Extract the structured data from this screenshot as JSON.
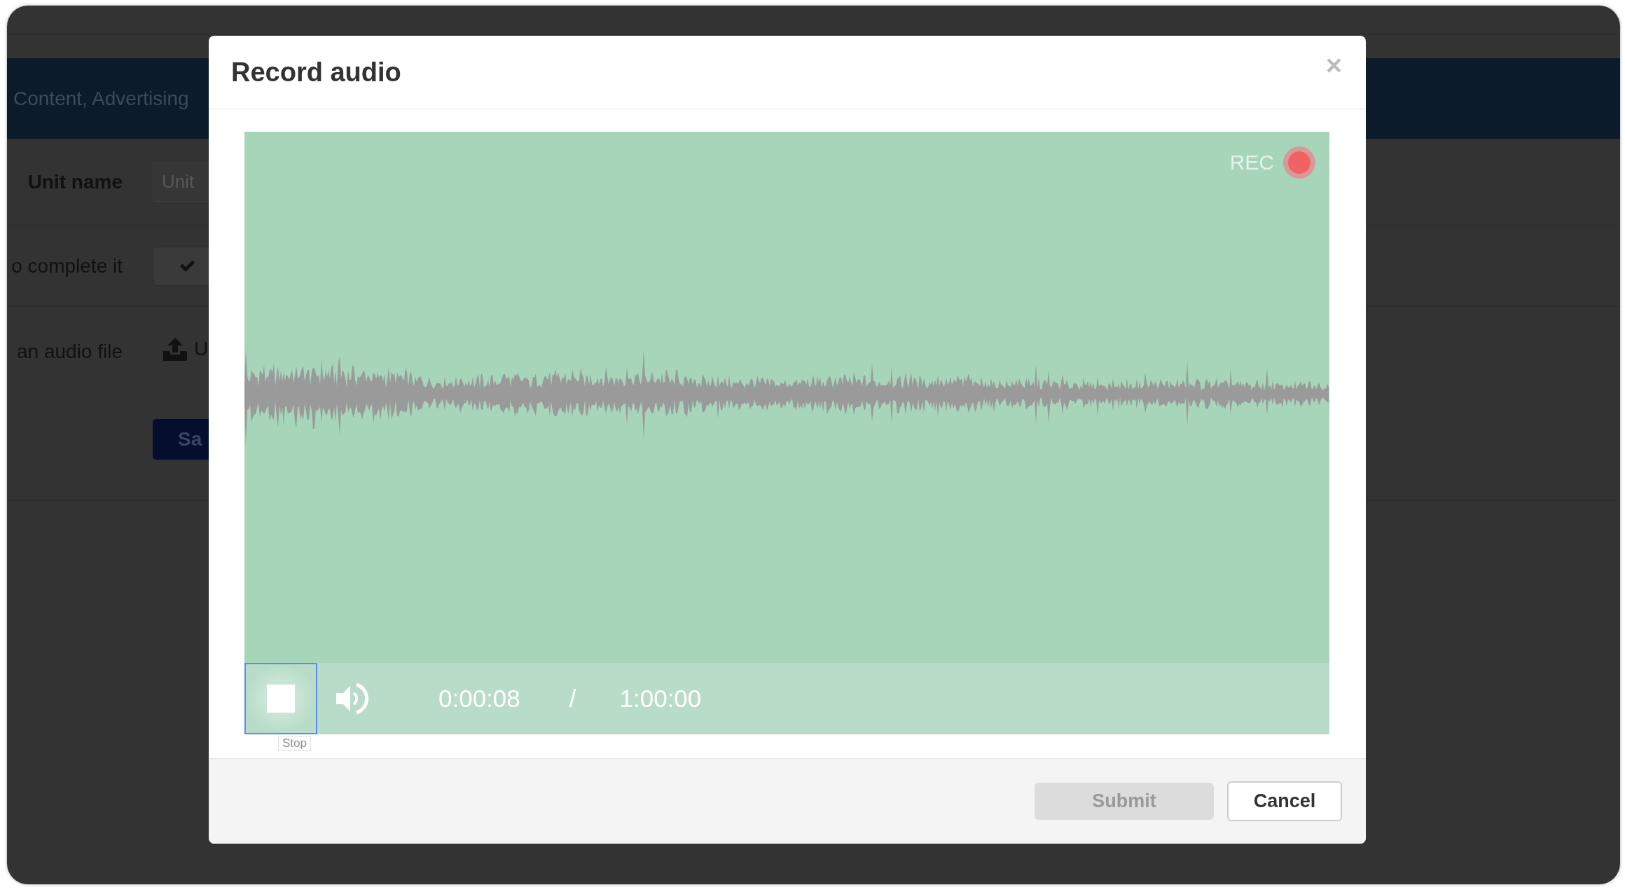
{
  "page": {
    "banner": "Content, Advertising",
    "form_rows": [
      {
        "kind": "input",
        "label": "Unit name",
        "strong": true,
        "placeholder": "Unit"
      },
      {
        "kind": "check_button",
        "label": "o complete it",
        "strong": false
      },
      {
        "kind": "upload",
        "label": "an audio file",
        "strong": false,
        "link": "U"
      },
      {
        "kind": "primary_button",
        "button": "Sa"
      }
    ]
  },
  "dialog": {
    "title": "Record audio",
    "close": "×",
    "recorder": {
      "rec_label": "REC",
      "recording": true,
      "stop_focused": true,
      "stop_tooltip": "Stop",
      "muted": false,
      "elapsed": "0:00:08",
      "separator": "/",
      "limit": "1:00:00"
    },
    "buttons": [
      {
        "kind": "submit",
        "label": "Submit",
        "disabled": true
      },
      {
        "kind": "cancel",
        "label": "Cancel",
        "disabled": false
      }
    ]
  }
}
